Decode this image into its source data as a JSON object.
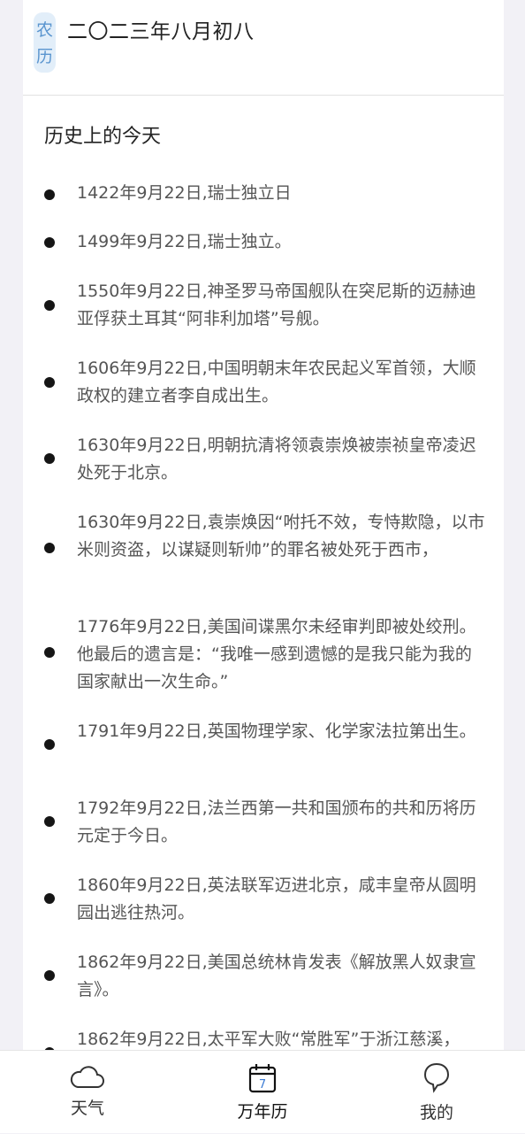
{
  "lunar": {
    "badge_top": "农",
    "badge_bottom": "历",
    "date": "二〇二三年八月初八"
  },
  "history": {
    "title": "历史上的今天",
    "events": [
      "1422年9月22日,瑞士独立日",
      "1499年9月22日,瑞士独立。",
      "1550年9月22日,神圣罗马帝国舰队在突尼斯的迈赫迪亚俘获土耳其“阿非利加塔”号舰。",
      "1606年9月22日,中国明朝末年农民起义军首领，大顺政权的建立者李自成出生。",
      "1630年9月22日,明朝抗清将领袁崇焕被崇祯皇帝凌迟处死于北京。",
      "1630年9月22日,袁崇焕因“咐托不效，专恃欺隐，以市米则资盗，以谋疑则斩帅”的罪名被处死于西市，",
      "1776年9月22日,美国间谍黑尔未经审判即被处绞刑。他最后的遗言是：“我唯一感到遗憾的是我只能为我的国家献出一次生命。”",
      "1791年9月22日,英国物理学家、化学家法拉第出生。",
      "1792年9月22日,法兰西第一共和国颁布的共和历将历元定于今日。",
      "1860年9月22日,英法联军迈进北京，咸丰皇帝从圆明园出逃往热河。",
      "1862年9月22日,美国总统林肯发表《解放黑人奴隶宣言》。",
      "1862年9月22日,太平军大败“常胜军”于浙江慈溪，"
    ]
  },
  "tabs": [
    {
      "label": "天气",
      "icon": "cloud-icon"
    },
    {
      "label": "万年历",
      "icon": "calendar-icon",
      "icon_text": "7",
      "active": true
    },
    {
      "label": "我的",
      "icon": "chat-bubble-icon"
    }
  ]
}
